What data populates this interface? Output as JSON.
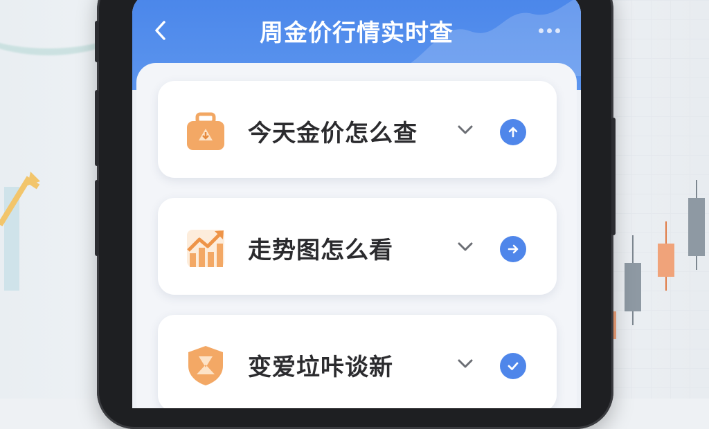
{
  "header": {
    "title": "周金价行情实时查",
    "back_icon": "chevron-left-icon",
    "more_icon": "more-dots-icon"
  },
  "colors": {
    "header_blue": "#4a86ea",
    "icon_orange": "#f0a25f",
    "action_blue": "#4f86ea",
    "text_dark": "#2b2b2e"
  },
  "items": [
    {
      "label": "今天金价怎么查",
      "icon": "briefcase-icon",
      "expand_icon": "chevron-down-icon",
      "action_icon": "arrow-up-circle-icon"
    },
    {
      "label": "走势图怎么看",
      "icon": "trend-chart-icon",
      "expand_icon": "chevron-down-icon",
      "action_icon": "arrow-right-circle-icon"
    },
    {
      "label": "变爱垃咔谈新",
      "icon": "shield-icon",
      "expand_icon": "chevron-down-icon",
      "action_icon": "check-circle-icon"
    }
  ]
}
